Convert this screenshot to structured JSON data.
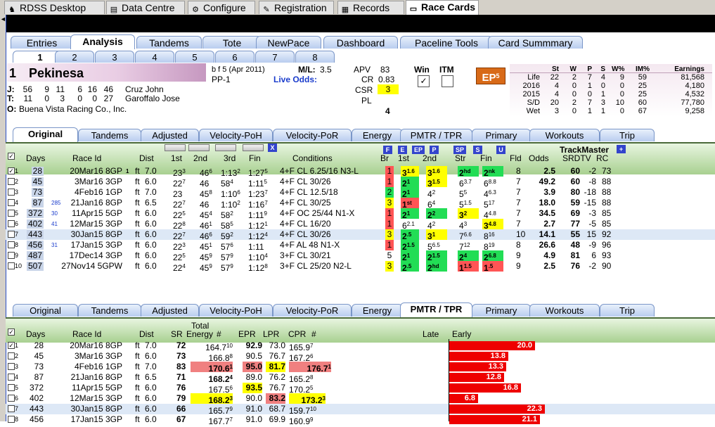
{
  "top_tabs": [
    {
      "label": "RDSS Desktop",
      "icon": "horse-icon"
    },
    {
      "label": "Data Centre",
      "icon": "folder-icon"
    },
    {
      "label": "Configure",
      "icon": "gear-icon"
    },
    {
      "label": "Registration",
      "icon": "registration-icon"
    },
    {
      "label": "Records",
      "icon": "grid-icon"
    },
    {
      "label": "Race Cards",
      "icon": "card-icon"
    }
  ],
  "sub_tabs": [
    "Entries",
    "Analysis",
    "Tandems",
    "Tote",
    "NewPace",
    "Dashboard",
    "Paceline Tools",
    "Card Summmary"
  ],
  "num_tabs": [
    "1",
    "2",
    "3",
    "4",
    "5",
    "6",
    "7",
    "8"
  ],
  "horse": {
    "post": "1",
    "name": "Pekinesa",
    "info": "b f 5  (Apr 2011)",
    "pp": "PP-1",
    "ml_label": "M/L:",
    "ml": "3.5",
    "live_odds": "Live Odds:",
    "j_label": "J:",
    "j_stats": [
      "56",
      "9",
      "11",
      "6",
      "16",
      "46"
    ],
    "jockey": "Cruz John",
    "t_label": "T:",
    "t_stats": [
      "11",
      "0",
      "3",
      "0",
      "0",
      "27"
    ],
    "trainer": "Garoffalo Jose",
    "o_label": "O:",
    "owner": "Buena Vista Racing Co., Inc.",
    "apv_label": "APV",
    "apv": "83",
    "cr_label": "CR",
    "cr": "0.83",
    "csr_label": "CSR",
    "csr": "3",
    "pl_label": "PL",
    "pl": "4",
    "win_label": "Win",
    "itm_label": "ITM",
    "ep_label": "EP",
    "ep_val": "5"
  },
  "stats_table": {
    "headers": [
      "St",
      "W",
      "P",
      "S",
      "W%",
      "IM%",
      "Earnings"
    ],
    "rows": [
      [
        "Life",
        "22",
        "2",
        "7",
        "4",
        "9",
        "59",
        "81,568"
      ],
      [
        "2016",
        "4",
        "0",
        "1",
        "0",
        "0",
        "25",
        "4,180"
      ],
      [
        "2015",
        "4",
        "0",
        "0",
        "1",
        "0",
        "25",
        "4,532"
      ],
      [
        "S/D",
        "20",
        "2",
        "7",
        "3",
        "10",
        "60",
        "77,780"
      ],
      [
        "Wet",
        "3",
        "0",
        "1",
        "1",
        "0",
        "67",
        "9,258"
      ]
    ]
  },
  "grid_tabs": [
    "Original",
    "Tandems",
    "Adjusted",
    "Velocity-PoH",
    "Velocity-PoR",
    "Energy",
    "PMTR / TPR",
    "Primary",
    "Workouts",
    "Trip"
  ],
  "grid1": {
    "headers": {
      "days": "Days",
      "raceid": "Race Id",
      "dist": "Dist",
      "c1": "1st",
      "c2": "2nd",
      "c3": "3rd",
      "fin": "Fin",
      "cond": "Conditions",
      "br": "Br",
      "st1": "1st",
      "st2": "2nd",
      "str": "Str",
      "fin2": "Fin",
      "fld": "Fld",
      "odds": "Odds",
      "trackmaster": "TrackMaster",
      "srdtv": "SRDTV",
      "rc": "RC"
    },
    "btn_letters": [
      "X",
      "F",
      "E",
      "EP",
      "P",
      "SP",
      "S",
      "U",
      "+"
    ],
    "rows": [
      {
        "n": "1",
        "chk": "✓",
        "days": "28",
        "lay": "",
        "raceid": "20Mar16 8GP",
        "note": "1",
        "surf": "ft",
        "dist": "7.0",
        "c1": "23",
        "c1s": "3",
        "c2": "46",
        "c2s": "6",
        "c3": "1:13",
        "c3s": "2",
        "fin": "1:27",
        "fins": "5",
        "cond": "4+F CL 6.25/16 N3-L",
        "br": "1",
        "s1": "3",
        "s1s": "1.6",
        "s2": "3",
        "s2s": "1.6",
        "str": "2",
        "strs": "hd",
        "f2": "2",
        "f2s": "nk",
        "fld": "8",
        "odds": "2.5",
        "sr": "60",
        "dtv": "-2",
        "rc": "73"
      },
      {
        "n": "2",
        "chk": "",
        "days": "45",
        "lay": "",
        "raceid": "3Mar16 3GP",
        "note": "",
        "surf": "ft",
        "dist": "6.0",
        "c1": "22",
        "c1s": "7",
        "c2": "46",
        "c2s": "",
        "c3": "58",
        "c3s": "4",
        "fin": "1:11",
        "fins": "5",
        "cond": "4+F CL 30/26",
        "br": "1",
        "s1": "2",
        "s1s": "1",
        "s2": "3",
        "s2s": "1.5",
        "str": "6",
        "strs": "3.7",
        "f2": "6",
        "f2s": "8.8",
        "fld": "7",
        "odds": "49.2",
        "sr": "60",
        "dtv": "-8",
        "rc": "88"
      },
      {
        "n": "3",
        "chk": "",
        "days": "73",
        "lay": "",
        "raceid": "4Feb16 1GP",
        "note": "",
        "surf": "ft",
        "dist": "7.0",
        "c1": "23",
        "c1s": "",
        "c2": "45",
        "c2s": "8",
        "c3": "1:10",
        "c3s": "6",
        "fin": "1:23",
        "fins": "7",
        "cond": "4+F CL 12.5/18",
        "br": "2",
        "s1": "2",
        "s1s": "1",
        "s2": "4",
        "s2s": "2",
        "str": "5",
        "strs": "5",
        "f2": "4",
        "f2s": "6.3",
        "fld": "7",
        "odds": "3.9",
        "sr": "80",
        "dtv": "-18",
        "rc": "88"
      },
      {
        "n": "4",
        "chk": "",
        "days": "87",
        "lay": "285",
        "raceid": "21Jan16 8GP",
        "note": "",
        "surf": "ft",
        "dist": "6.5",
        "c1": "22",
        "c1s": "7",
        "c2": "46",
        "c2s": "",
        "c3": "1:10",
        "c3s": "2",
        "fin": "1:16",
        "fins": "7",
        "cond": "4+F CL 30/25",
        "br": "3",
        "s1": "1",
        "s1s": "st",
        "s2": "6",
        "s2s": "4",
        "str": "5",
        "strs": "1.5",
        "f2": "5",
        "f2s": "17",
        "fld": "7",
        "odds": "18.0",
        "sr": "59",
        "dtv": "-15",
        "rc": "88"
      },
      {
        "n": "5",
        "chk": "",
        "days": "372",
        "lay": "30",
        "raceid": "11Apr15 5GP",
        "note": "",
        "surf": "ft",
        "dist": "6.0",
        "c1": "22",
        "c1s": "5",
        "c2": "45",
        "c2s": "4",
        "c3": "58",
        "c3s": "2",
        "fin": "1:11",
        "fins": "9",
        "cond": "4+F OC 25/44 N1-X",
        "br": "1",
        "s1": "2",
        "s1s": "1",
        "s2": "2",
        "s2s": "2",
        "str": "3",
        "strs": "2",
        "f2": "4",
        "f2s": "4.8",
        "fld": "7",
        "odds": "34.5",
        "sr": "69",
        "dtv": "-3",
        "rc": "85"
      },
      {
        "n": "6",
        "chk": "",
        "days": "402",
        "lay": "41",
        "raceid": "12Mar15 3GP",
        "note": "",
        "surf": "ft",
        "dist": "6.0",
        "c1": "22",
        "c1s": "8",
        "c2": "46",
        "c2s": "1",
        "c3": "58",
        "c3s": "5",
        "fin": "1:12",
        "fins": "1",
        "cond": "4+F CL 16/20",
        "br": "1",
        "s1": "6",
        "s1s": "2.1",
        "s2": "4",
        "s2s": "2",
        "str": "4",
        "strs": "3",
        "f2": "3",
        "f2s": "4.8",
        "fld": "7",
        "odds": "2.7",
        "sr": "77",
        "dtv": "-5",
        "rc": "85"
      },
      {
        "n": "7",
        "chk": "",
        "days": "443",
        "lay": "",
        "raceid": "30Jan15 8GP",
        "note": "",
        "surf": "ft",
        "dist": "6.0",
        "c1": "22",
        "c1s": "7",
        "c2": "46",
        "c2s": "6",
        "c3": "59",
        "c3s": "2",
        "fin": "1:12",
        "fins": "4",
        "cond": "4+F CL 30/26",
        "br": "3",
        "s1": "2",
        "s1s": ".5",
        "s2": "3",
        "s2s": "1",
        "str": "7",
        "strs": "6.6",
        "f2": "8",
        "f2s": "16",
        "fld": "10",
        "odds": "14.1",
        "sr": "55",
        "dtv": "15",
        "rc": "92"
      },
      {
        "n": "8",
        "chk": "",
        "days": "456",
        "lay": "31",
        "raceid": "17Jan15 3GP",
        "note": "",
        "surf": "ft",
        "dist": "6.0",
        "c1": "22",
        "c1s": "3",
        "c2": "45",
        "c2s": "1",
        "c3": "57",
        "c3s": "6",
        "fin": "1:11",
        "fins": "",
        "cond": "4+F AL 48 N1-X",
        "br": "1",
        "s1": "2",
        "s1s": "1.5",
        "s2": "5",
        "s2s": "6.5",
        "str": "7",
        "strs": "12",
        "f2": "8",
        "f2s": "19",
        "fld": "8",
        "odds": "26.6",
        "sr": "48",
        "dtv": "-9",
        "rc": "96"
      },
      {
        "n": "9",
        "chk": "",
        "days": "487",
        "lay": "",
        "raceid": "17Dec14 3GP",
        "note": "",
        "surf": "ft",
        "dist": "6.0",
        "c1": "22",
        "c1s": "5",
        "c2": "45",
        "c2s": "9",
        "c3": "57",
        "c3s": "9",
        "fin": "1:10",
        "fins": "4",
        "cond": "3+F CL 30/21",
        "br": "5",
        "s1": "2",
        "s1s": "1",
        "s2": "2",
        "s2s": "1.5",
        "str": "2",
        "strs": "4",
        "f2": "2",
        "f2s": "6.8",
        "fld": "9",
        "odds": "4.9",
        "sr": "81",
        "dtv": "6",
        "rc": "93"
      },
      {
        "n": "10",
        "chk": "",
        "days": "507",
        "lay": "",
        "raceid": "27Nov14 5GPW",
        "note": "",
        "surf": "ft",
        "dist": "6.0",
        "c1": "22",
        "c1s": "4",
        "c2": "45",
        "c2s": "9",
        "c3": "57",
        "c3s": "9",
        "fin": "1:12",
        "fins": "8",
        "cond": "3+F CL 25/20 N2-L",
        "br": "3",
        "s1": "2",
        "s1s": ".5",
        "s2": "2",
        "s2s": "hd",
        "str": "1",
        "strs": "1.5",
        "f2": "1",
        "f2s": ".5",
        "fld": "9",
        "odds": "2.5",
        "sr": "76",
        "dtv": "-2",
        "rc": "90"
      }
    ]
  },
  "grid2": {
    "headers": {
      "days": "Days",
      "raceid": "Race Id",
      "dist": "Dist",
      "sr": "SR",
      "total": "Total",
      "energy": "Energy",
      "hash": "#",
      "epr": "EPR",
      "lpr": "LPR",
      "cpr": "CPR",
      "hash2": "#",
      "late": "Late",
      "early": "Early"
    },
    "rows": [
      {
        "n": "1",
        "chk": "✓",
        "days": "28",
        "raceid": "20Mar16 8GP",
        "surf": "ft",
        "dist": "7.0",
        "sr": "72",
        "energy": "164.7",
        "es": "10",
        "epr": "92.9",
        "lpr": "73.0",
        "cpr": "165.9",
        "cs": "7",
        "early": 20.0
      },
      {
        "n": "2",
        "chk": "",
        "days": "45",
        "raceid": "3Mar16 3GP",
        "surf": "ft",
        "dist": "6.0",
        "sr": "73",
        "energy": "166.8",
        "es": "8",
        "epr": "90.5",
        "lpr": "76.7",
        "cpr": "167.2",
        "cs": "6",
        "early": 13.8
      },
      {
        "n": "3",
        "chk": "",
        "days": "73",
        "raceid": "4Feb16 1GP",
        "surf": "ft",
        "dist": "7.0",
        "sr": "83",
        "energy": "170.6",
        "es": "1",
        "epr": "95.0",
        "lpr": "81.7",
        "cpr": "176.7",
        "cs": "1",
        "early": 13.3
      },
      {
        "n": "4",
        "chk": "",
        "days": "87",
        "raceid": "21Jan16 8GP",
        "surf": "ft",
        "dist": "6.5",
        "sr": "71",
        "energy": "168.2",
        "es": "4",
        "epr": "89.0",
        "lpr": "76.2",
        "cpr": "165.2",
        "cs": "8",
        "early": 12.8
      },
      {
        "n": "5",
        "chk": "",
        "days": "372",
        "raceid": "11Apr15 5GP",
        "surf": "ft",
        "dist": "6.0",
        "sr": "76",
        "energy": "167.5",
        "es": "6",
        "epr": "93.5",
        "lpr": "76.7",
        "cpr": "170.2",
        "cs": "5",
        "early": 16.8
      },
      {
        "n": "6",
        "chk": "",
        "days": "402",
        "raceid": "12Mar15 3GP",
        "surf": "ft",
        "dist": "6.0",
        "sr": "79",
        "energy": "168.2",
        "es": "3",
        "epr": "90.0",
        "lpr": "83.2",
        "cpr": "173.2",
        "cs": "3",
        "early": 6.8
      },
      {
        "n": "7",
        "chk": "",
        "days": "443",
        "raceid": "30Jan15 8GP",
        "surf": "ft",
        "dist": "6.0",
        "sr": "66",
        "energy": "165.7",
        "es": "9",
        "epr": "91.0",
        "lpr": "68.7",
        "cpr": "159.7",
        "cs": "10",
        "early": 22.3
      },
      {
        "n": "8",
        "chk": "",
        "days": "456",
        "raceid": "17Jan15 3GP",
        "surf": "ft",
        "dist": "6.0",
        "sr": "67",
        "energy": "167.7",
        "es": "7",
        "epr": "91.0",
        "lpr": "69.9",
        "cpr": "160.9",
        "cs": "9",
        "early": 21.1
      }
    ]
  },
  "colors": {
    "accent_blue": "#2a4fc8",
    "highlight_yellow": "#ffff00",
    "highlight_green": "#22dd55",
    "highlight_red": "#ff5555",
    "bar_red": "#ee0000"
  }
}
